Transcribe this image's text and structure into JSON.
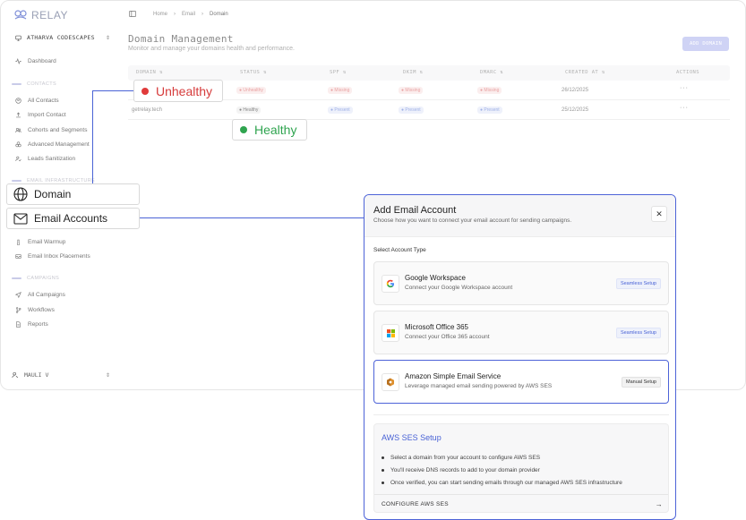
{
  "app": {
    "brand": "RELAY",
    "workspace": "ATHARVA CODESCAPES",
    "user": "MAULI V"
  },
  "sidebar": {
    "dashboard": "Dashboard",
    "sections": {
      "contacts": "CONTACTS",
      "email_infrastructure": "EMAIL INFRASTRUCTURE",
      "campaigns": "CAMPAIGNS"
    },
    "contacts_items": [
      "All Contacts",
      "Import Contact",
      "Cohorts and Segments",
      "Advanced Management",
      "Leads Sanitization"
    ],
    "infra_items": [
      "Email Warmup",
      "Email Inbox Placements"
    ],
    "campaign_items": [
      "All Campaigns",
      "Workflows",
      "Reports"
    ]
  },
  "breadcrumb": [
    "Home",
    "Email",
    "Domain"
  ],
  "page": {
    "title": "Domain Management",
    "subtitle": "Monitor and manage your domains health and performance.",
    "add_button": "ADD DOMAIN"
  },
  "table": {
    "headers": [
      "DOMAIN",
      "STATUS",
      "SPF",
      "DKIM",
      "DMARC",
      "CREATED AT",
      "ACTIONS"
    ],
    "rows": [
      {
        "domain": "",
        "status": "Unhealthy",
        "spf": "Missing",
        "dkim": "Missing",
        "dmarc": "Missing",
        "created": "26/12/2025",
        "actions": "···"
      },
      {
        "domain": "getrelay.tech",
        "status": "Healthy",
        "spf": "Present",
        "dkim": "Present",
        "dmarc": "Present",
        "created": "25/12/2025",
        "actions": "···"
      }
    ]
  },
  "callouts": {
    "unhealthy": "Unhealthy",
    "healthy": "Healthy",
    "domain": "Domain",
    "email_accounts": "Email Accounts"
  },
  "modal": {
    "title": "Add Email Account",
    "subtitle": "Choose how you want to connect your email account for sending campaigns.",
    "close": "✕",
    "select_label": "Select Account Type",
    "options": [
      {
        "title": "Google Workspace",
        "desc": "Connect your Google Workspace account",
        "badge": "Seamless Setup"
      },
      {
        "title": "Microsoft Office 365",
        "desc": "Connect your Office 365 account",
        "badge": "Seamless Setup"
      },
      {
        "title": "Amazon Simple Email Service",
        "desc": "Leverage managed email sending powered by AWS SES",
        "badge": "Manual Setup"
      }
    ],
    "ses": {
      "title": "AWS SES Setup",
      "steps": [
        "Select a domain from your account to configure AWS SES",
        "You'll receive DNS records to add to your domain provider",
        "Once verified, you can start sending emails through our managed AWS SES infrastructure"
      ],
      "button": "CONFIGURE AWS SES",
      "arrow": "→"
    }
  },
  "colors": {
    "accent": "#4a63d6",
    "unhealthy": "#d63b3b",
    "healthy": "#2fa44f"
  }
}
